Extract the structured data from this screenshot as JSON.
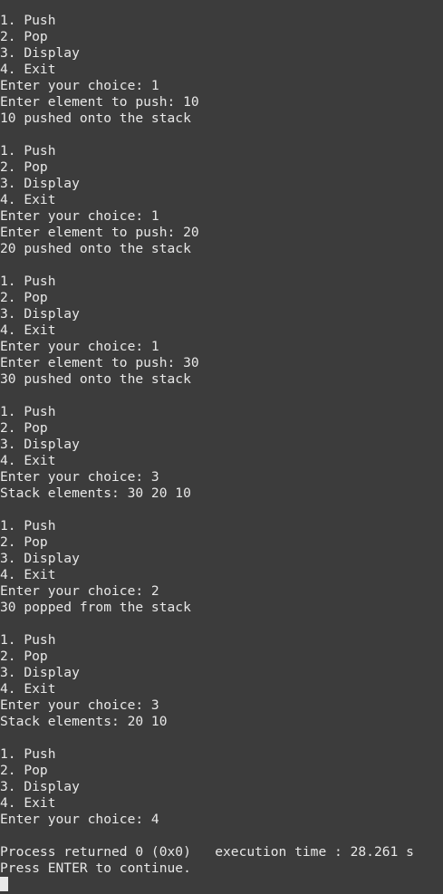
{
  "terminal": {
    "lines": [
      "1. Push",
      "2. Pop",
      "3. Display",
      "4. Exit",
      "Enter your choice: 1",
      "Enter element to push: 10",
      "10 pushed onto the stack",
      "",
      "1. Push",
      "2. Pop",
      "3. Display",
      "4. Exit",
      "Enter your choice: 1",
      "Enter element to push: 20",
      "20 pushed onto the stack",
      "",
      "1. Push",
      "2. Pop",
      "3. Display",
      "4. Exit",
      "Enter your choice: 1",
      "Enter element to push: 30",
      "30 pushed onto the stack",
      "",
      "1. Push",
      "2. Pop",
      "3. Display",
      "4. Exit",
      "Enter your choice: 3",
      "Stack elements: 30 20 10",
      "",
      "1. Push",
      "2. Pop",
      "3. Display",
      "4. Exit",
      "Enter your choice: 2",
      "30 popped from the stack",
      "",
      "1. Push",
      "2. Pop",
      "3. Display",
      "4. Exit",
      "Enter your choice: 3",
      "Stack elements: 20 10",
      "",
      "1. Push",
      "2. Pop",
      "3. Display",
      "4. Exit",
      "Enter your choice: 4",
      "",
      "Process returned 0 (0x0)   execution time : 28.261 s",
      "Press ENTER to continue."
    ]
  },
  "colors": {
    "background": "#3c3c3c",
    "text": "#e8e8e8"
  }
}
